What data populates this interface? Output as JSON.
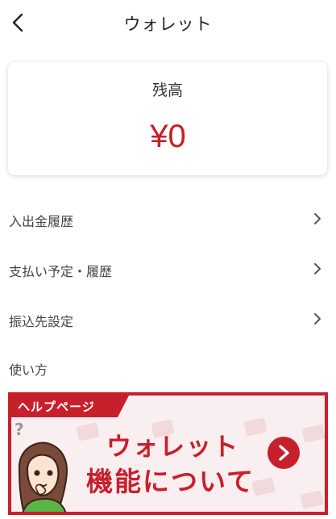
{
  "header": {
    "title": "ウォレット",
    "back_icon": "chevron-left-icon"
  },
  "balance": {
    "label": "残高",
    "value": "¥0",
    "value_color": "#cc1c24"
  },
  "menu": {
    "items": [
      {
        "label": "入出金履歴",
        "icon": "chevron-right-icon"
      },
      {
        "label": "支払い予定・履歴",
        "icon": "chevron-right-icon"
      },
      {
        "label": "振込先設定",
        "icon": "chevron-right-icon"
      },
      {
        "label": "使い方"
      }
    ]
  },
  "help_banner": {
    "tab_label": "ヘルプページ",
    "title_line1": "ウォレット",
    "title_line2": "機能について",
    "arrow_icon": "chevron-right-circle-icon",
    "accent_color": "#c8202b"
  }
}
